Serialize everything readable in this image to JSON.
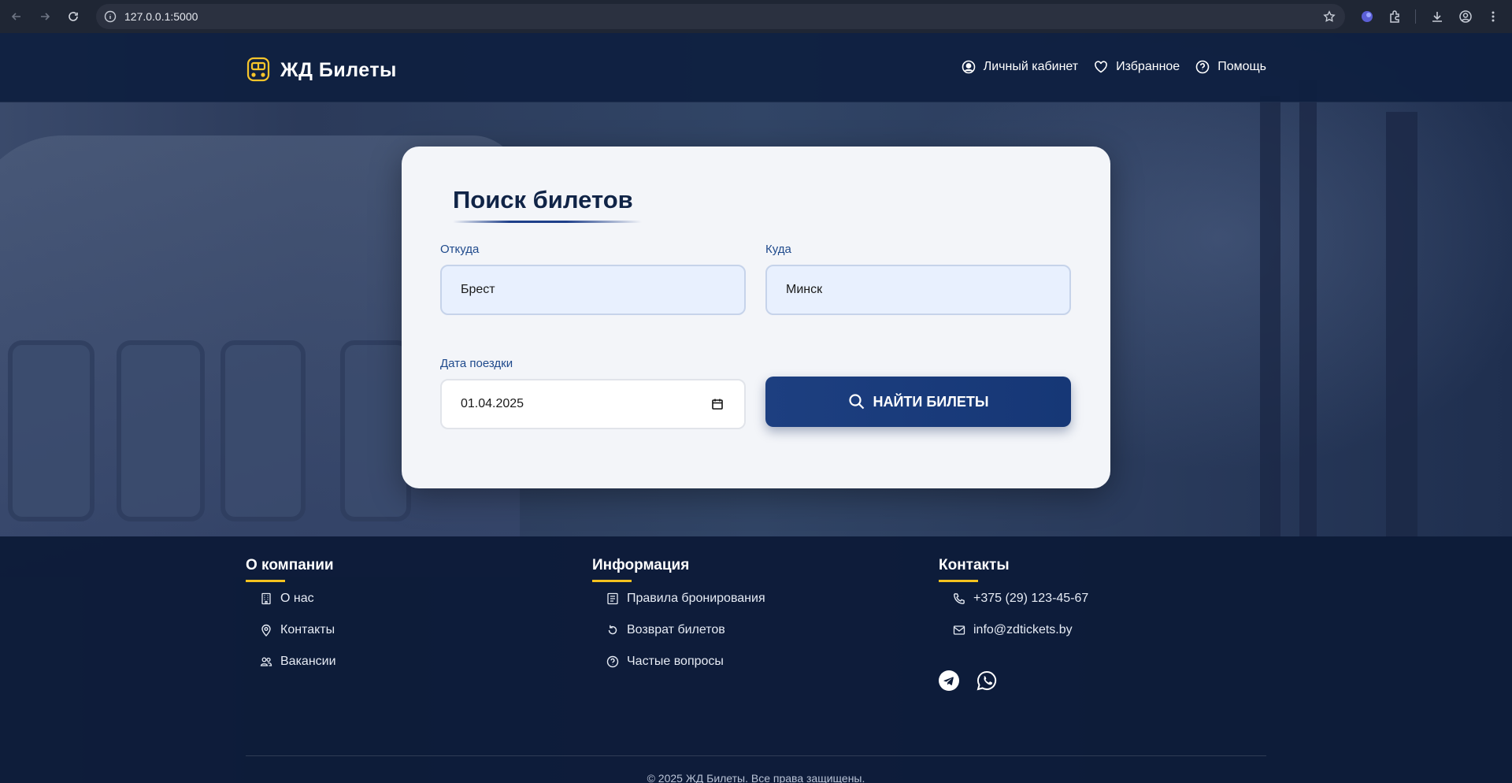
{
  "browser": {
    "url": "127.0.0.1:5000"
  },
  "header": {
    "logo_text": "ЖД Билеты",
    "nav": [
      {
        "label": "Личный кабинет",
        "icon": "user-circle-icon"
      },
      {
        "label": "Избранное",
        "icon": "heart-icon"
      },
      {
        "label": "Помощь",
        "icon": "question-circle-icon"
      }
    ]
  },
  "search": {
    "title": "Поиск билетов",
    "from_label": "Откуда",
    "from_value": "Брест",
    "to_label": "Куда",
    "to_value": "Минск",
    "date_label": "Дата поездки",
    "date_value": "01.04.2025",
    "button_label": "НАЙТИ БИЛЕТЫ"
  },
  "footer": {
    "columns": [
      {
        "title": "О компании",
        "links": [
          {
            "label": "О нас",
            "icon": "building-icon"
          },
          {
            "label": "Контакты",
            "icon": "map-pin-icon"
          },
          {
            "label": "Вакансии",
            "icon": "people-icon"
          }
        ]
      },
      {
        "title": "Информация",
        "links": [
          {
            "label": "Правила бронирования",
            "icon": "document-icon"
          },
          {
            "label": "Возврат билетов",
            "icon": "refresh-icon"
          },
          {
            "label": "Частые вопросы",
            "icon": "question-circle-icon"
          }
        ]
      },
      {
        "title": "Контакты",
        "links": [
          {
            "label": "+375 (29) 123-45-67",
            "icon": "phone-icon"
          },
          {
            "label": "info@zdtickets.by",
            "icon": "envelope-icon"
          }
        ]
      }
    ],
    "social": [
      {
        "icon": "telegram-icon"
      },
      {
        "icon": "whatsapp-icon"
      }
    ],
    "copyright": "© 2025 ЖД Билеты. Все права защищены."
  },
  "colors": {
    "header_bg": "#0e1f3f",
    "accent_yellow": "#f4c21f",
    "button_blue": "#1d3f80",
    "card_bg": "#f3f5f9"
  }
}
